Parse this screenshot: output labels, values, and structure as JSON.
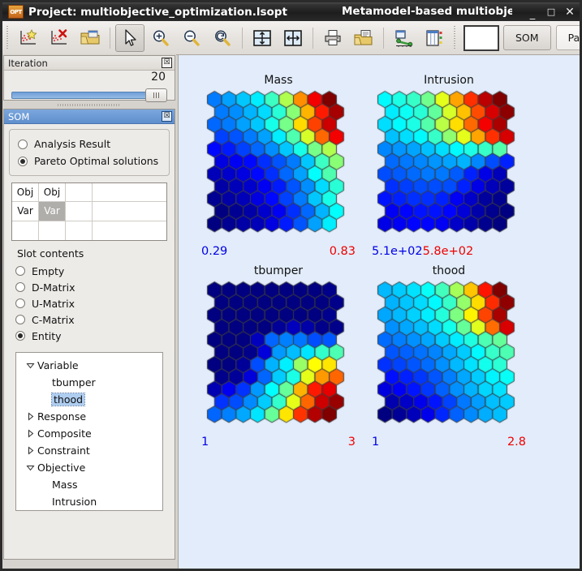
{
  "window": {
    "app_icon_text": "OPT",
    "title_left": "Project: multiobjective_optimization.lsopt",
    "title_center": "Metamodel-based multiobjec",
    "minimize": "_",
    "maximize": "□",
    "close": "✕"
  },
  "toolbar": {
    "buttons": [
      {
        "name": "add-scatter-point-icon",
        "label": ""
      },
      {
        "name": "delete-scatter-point-icon",
        "label": ""
      },
      {
        "name": "open-folder-icon",
        "label": ""
      },
      {
        "name": "pointer-tool-icon",
        "label": ""
      },
      {
        "name": "zoom-in-icon",
        "label": ""
      },
      {
        "name": "zoom-out-icon",
        "label": ""
      },
      {
        "name": "zoom-reset-icon",
        "label": ""
      },
      {
        "name": "fit-vertical-icon",
        "label": ""
      },
      {
        "name": "fit-horizontal-icon",
        "label": ""
      },
      {
        "name": "print-icon",
        "label": ""
      },
      {
        "name": "save-as-icon",
        "label": ""
      },
      {
        "name": "curve-plot-icon",
        "label": ""
      },
      {
        "name": "table-view-icon",
        "label": ""
      }
    ],
    "color_swatch": "#ffffff",
    "som_button": "SOM",
    "parameter_button": "Paramete"
  },
  "iteration_panel": {
    "title": "Iteration",
    "value": "20",
    "close": "☒",
    "slider_percent": 100
  },
  "som_panel": {
    "title": "SOM",
    "close": "☒",
    "source_options": [
      {
        "label": "Analysis Result",
        "selected": false
      },
      {
        "label": "Pareto Optimal solutions",
        "selected": true
      }
    ],
    "slot_table": {
      "rows": [
        [
          {
            "text": "Obj",
            "selected": false
          },
          {
            "text": "Obj",
            "selected": false
          },
          {
            "text": "",
            "selected": false
          }
        ],
        [
          {
            "text": "Var",
            "selected": false
          },
          {
            "text": "Var",
            "selected": true
          },
          {
            "text": "",
            "selected": false
          }
        ],
        [
          {
            "text": "",
            "selected": false
          },
          {
            "text": "",
            "selected": false
          },
          {
            "text": "",
            "selected": false
          }
        ]
      ]
    },
    "slot_contents_label": "Slot contents",
    "slot_contents_options": [
      {
        "label": "Empty",
        "selected": false
      },
      {
        "label": "D-Matrix",
        "selected": false
      },
      {
        "label": "U-Matrix",
        "selected": false
      },
      {
        "label": "C-Matrix",
        "selected": false
      },
      {
        "label": "Entity",
        "selected": true
      }
    ],
    "tree": [
      {
        "label": "Variable",
        "level": 0,
        "expander": "expanded"
      },
      {
        "label": "tbumper",
        "level": 1,
        "expander": "none",
        "selected": false
      },
      {
        "label": "thood",
        "level": 1,
        "expander": "none",
        "selected": true
      },
      {
        "label": "Response",
        "level": 0,
        "expander": "collapsed"
      },
      {
        "label": "Composite",
        "level": 0,
        "expander": "collapsed"
      },
      {
        "label": "Constraint",
        "level": 0,
        "expander": "collapsed"
      },
      {
        "label": "Objective",
        "level": 0,
        "expander": "expanded"
      },
      {
        "label": "Mass",
        "level": 1,
        "expander": "none",
        "selected": false
      },
      {
        "label": "Intrusion",
        "level": 1,
        "expander": "none",
        "selected": false
      }
    ]
  },
  "chart_data": [
    {
      "type": "heatmap",
      "name": "mass-som",
      "title": "Mass",
      "min_label": "0.29",
      "max_label": "0.83",
      "min_color": "#0000e6",
      "max_color": "#ee0000",
      "grid": {
        "cols": 9,
        "rows": 11,
        "layout": "hex-offset"
      },
      "colormap": "jet-reversed",
      "description": "Self-organizing map component plane for Mass; low values (blue) at top-right, high values (red) at bottom-right, gradient runs diagonally.",
      "values": [
        [
          0.42,
          0.44,
          0.46,
          0.48,
          0.52,
          0.58,
          0.68,
          0.76,
          0.82
        ],
        [
          0.42,
          0.43,
          0.45,
          0.47,
          0.51,
          0.56,
          0.66,
          0.74,
          0.8
        ],
        [
          0.41,
          0.42,
          0.44,
          0.46,
          0.5,
          0.55,
          0.64,
          0.72,
          0.78
        ],
        [
          0.39,
          0.4,
          0.42,
          0.44,
          0.48,
          0.53,
          0.6,
          0.7,
          0.76
        ],
        [
          0.36,
          0.37,
          0.39,
          0.41,
          0.43,
          0.46,
          0.5,
          0.55,
          0.58
        ],
        [
          0.34,
          0.35,
          0.36,
          0.38,
          0.4,
          0.42,
          0.46,
          0.52,
          0.56
        ],
        [
          0.32,
          0.33,
          0.34,
          0.36,
          0.38,
          0.41,
          0.44,
          0.49,
          0.53
        ],
        [
          0.31,
          0.32,
          0.33,
          0.35,
          0.37,
          0.4,
          0.43,
          0.47,
          0.51
        ],
        [
          0.3,
          0.31,
          0.32,
          0.34,
          0.36,
          0.39,
          0.42,
          0.46,
          0.5
        ],
        [
          0.29,
          0.3,
          0.31,
          0.33,
          0.35,
          0.38,
          0.41,
          0.45,
          0.49
        ],
        [
          0.29,
          0.3,
          0.31,
          0.32,
          0.34,
          0.37,
          0.4,
          0.44,
          0.48
        ]
      ]
    },
    {
      "type": "heatmap",
      "name": "intrusion-som",
      "title": "Intrusion",
      "min_label": "5.1e+02",
      "max_label": "5.8e+02",
      "min_color": "#0000e6",
      "max_color": "#ee0000",
      "grid": {
        "cols": 9,
        "rows": 11,
        "layout": "hex-offset"
      },
      "colormap": "jet-reversed",
      "description": "Component plane for Intrusion; high values (red) at top-right, low values (blue) at bottom-right.",
      "values": [
        [
          536,
          538,
          540,
          544,
          552,
          560,
          568,
          576,
          580
        ],
        [
          535,
          537,
          539,
          543,
          551,
          558,
          566,
          574,
          579
        ],
        [
          534,
          536,
          538,
          542,
          549,
          556,
          564,
          572,
          577
        ],
        [
          532,
          534,
          536,
          540,
          546,
          552,
          560,
          568,
          574
        ],
        [
          528,
          529,
          530,
          532,
          534,
          536,
          538,
          540,
          542
        ],
        [
          526,
          527,
          528,
          529,
          530,
          531,
          528,
          524,
          521
        ],
        [
          524,
          525,
          526,
          527,
          527,
          525,
          521,
          517,
          514
        ],
        [
          522,
          523,
          524,
          524,
          524,
          521,
          517,
          514,
          512
        ],
        [
          520,
          521,
          522,
          522,
          521,
          518,
          515,
          512,
          511
        ],
        [
          518,
          519,
          520,
          520,
          519,
          516,
          513,
          511,
          510
        ],
        [
          517,
          518,
          519,
          519,
          518,
          515,
          513,
          511,
          510
        ]
      ]
    },
    {
      "type": "heatmap",
      "name": "tbumper-som",
      "title": "tbumper",
      "min_label": "1",
      "max_label": "3",
      "min_color": "#0000e6",
      "max_color": "#ee0000",
      "grid": {
        "cols": 9,
        "rows": 11,
        "layout": "hex-offset"
      },
      "colormap": "jet-reversed",
      "description": "Component plane for tbumper; uniformly low (blue) across the top two-thirds, rising to high (red) at the bottom-right corner.",
      "values": [
        [
          1.0,
          1.0,
          1.0,
          1.0,
          1.0,
          1.0,
          1.0,
          1.0,
          1.02
        ],
        [
          1.0,
          1.0,
          1.0,
          1.0,
          1.0,
          1.0,
          1.0,
          1.0,
          1.02
        ],
        [
          1.0,
          1.0,
          1.0,
          1.0,
          1.0,
          1.0,
          1.0,
          1.0,
          1.03
        ],
        [
          1.0,
          1.0,
          1.0,
          1.0,
          1.05,
          1.12,
          1.08,
          1.02,
          1.02
        ],
        [
          1.0,
          1.0,
          1.0,
          1.12,
          1.45,
          1.5,
          1.48,
          1.4,
          1.42
        ],
        [
          1.0,
          1.0,
          1.02,
          1.18,
          1.55,
          1.62,
          1.7,
          1.85,
          1.9
        ],
        [
          1.0,
          1.0,
          1.05,
          1.4,
          1.6,
          1.72,
          2.05,
          2.25,
          2.3
        ],
        [
          1.02,
          1.05,
          1.18,
          1.45,
          1.65,
          1.8,
          2.2,
          2.45,
          2.55
        ],
        [
          1.1,
          1.22,
          1.35,
          1.55,
          1.75,
          1.95,
          2.4,
          2.7,
          2.8
        ],
        [
          1.35,
          1.4,
          1.52,
          1.65,
          1.85,
          2.2,
          2.55,
          2.85,
          2.95
        ],
        [
          1.45,
          1.5,
          1.58,
          1.7,
          1.95,
          2.3,
          2.65,
          2.9,
          3.0
        ]
      ]
    },
    {
      "type": "heatmap",
      "name": "thood-som",
      "title": "thood",
      "min_label": "1",
      "max_label": "2.8",
      "min_color": "#0000e6",
      "max_color": "#ee0000",
      "grid": {
        "cols": 9,
        "rows": 11,
        "layout": "hex-offset"
      },
      "colormap": "jet-reversed",
      "description": "Component plane for thood; low values (blue) at top-right, high values (red) at bottom-right.",
      "values": [
        [
          1.55,
          1.58,
          1.62,
          1.68,
          1.78,
          1.95,
          2.2,
          2.5,
          2.75
        ],
        [
          1.54,
          1.57,
          1.61,
          1.66,
          1.76,
          1.92,
          2.16,
          2.46,
          2.72
        ],
        [
          1.52,
          1.55,
          1.59,
          1.64,
          1.73,
          1.88,
          2.12,
          2.42,
          2.68
        ],
        [
          1.48,
          1.52,
          1.56,
          1.61,
          1.7,
          1.84,
          2.05,
          2.35,
          2.6
        ],
        [
          1.42,
          1.45,
          1.48,
          1.52,
          1.58,
          1.64,
          1.72,
          1.8,
          1.84
        ],
        [
          1.38,
          1.4,
          1.43,
          1.46,
          1.52,
          1.58,
          1.66,
          1.76,
          1.8
        ],
        [
          1.32,
          1.35,
          1.38,
          1.42,
          1.48,
          1.55,
          1.62,
          1.7,
          1.74
        ],
        [
          1.26,
          1.29,
          1.33,
          1.38,
          1.45,
          1.52,
          1.58,
          1.65,
          1.68
        ],
        [
          1.18,
          1.22,
          1.27,
          1.33,
          1.4,
          1.48,
          1.54,
          1.6,
          1.62
        ],
        [
          1.1,
          1.14,
          1.2,
          1.27,
          1.35,
          1.44,
          1.5,
          1.56,
          1.58
        ],
        [
          1.02,
          1.06,
          1.12,
          1.2,
          1.3,
          1.4,
          1.47,
          1.53,
          1.56
        ]
      ]
    }
  ]
}
